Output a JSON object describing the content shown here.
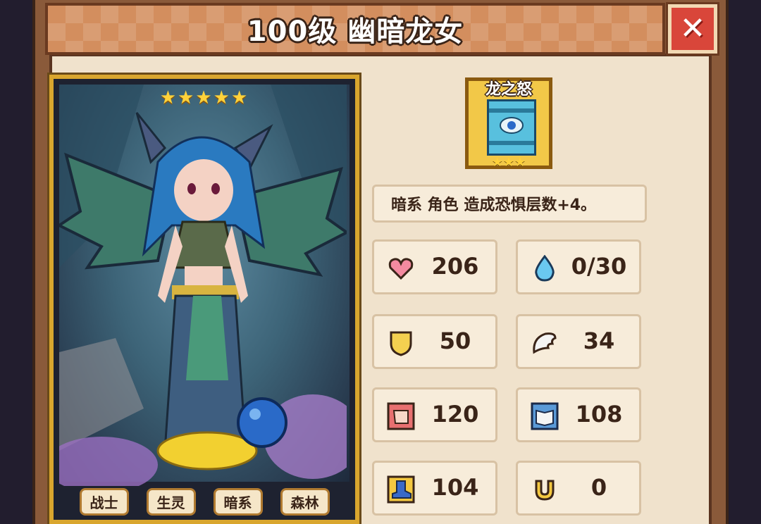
{
  "title": "100级 幽暗龙女",
  "close_label": "✕",
  "card": {
    "stars": "★★★★★",
    "tags": [
      "战士",
      "生灵",
      "暗系",
      "森林"
    ]
  },
  "skill": {
    "name": "龙之怒",
    "stars": "★★★"
  },
  "description": "暗系 角色 造成恐惧层数+4。",
  "stats": [
    {
      "icon": "heart-icon",
      "value": "206"
    },
    {
      "icon": "water-drop-icon",
      "value": "0/30"
    },
    {
      "icon": "shield-icon",
      "value": "50"
    },
    {
      "icon": "wing-icon",
      "value": "34"
    },
    {
      "icon": "fist-icon",
      "value": "120"
    },
    {
      "icon": "book-icon",
      "value": "108"
    },
    {
      "icon": "boot-icon",
      "value": "104"
    },
    {
      "icon": "horseshoe-icon",
      "value": "0"
    }
  ]
}
